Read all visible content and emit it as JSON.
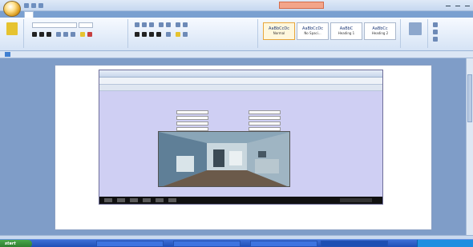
{
  "window": {
    "title": "",
    "contextual_tab": ""
  },
  "ribbon": {
    "tabs": [
      "",
      "",
      "",
      "",
      "",
      "",
      "",
      ""
    ],
    "styles": [
      {
        "sample": "AaBbCcDc",
        "name": "Normal"
      },
      {
        "sample": "AaBbCcDc",
        "name": "No Spaci..."
      },
      {
        "sample": "AaBbC",
        "name": "Heading 1"
      },
      {
        "sample": "AaBbCc",
        "name": "Heading 2"
      }
    ],
    "groups": [
      "",
      "",
      "",
      "",
      ""
    ]
  },
  "embedded_screenshot": {
    "form_title": "",
    "fields_left": [
      "",
      "",
      "",
      "",
      "",
      ""
    ],
    "fields_right": [
      "",
      "",
      "",
      "",
      ""
    ]
  },
  "status": {
    "page_count": "",
    "zoom": ""
  },
  "taskbar": {
    "start": "start",
    "items": [
      "",
      "",
      "",
      "",
      ""
    ],
    "clock": ""
  }
}
